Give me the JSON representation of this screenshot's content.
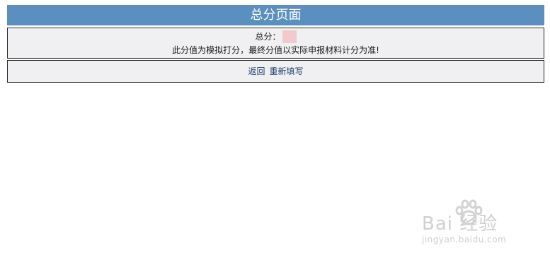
{
  "header": {
    "title": "总分页面"
  },
  "score": {
    "label": "总分：",
    "value": "",
    "note": "此分值为模拟打分，最终分值以实际申报材料计分为准!"
  },
  "actions": {
    "back_label": "返回",
    "refill_label": "重新填写"
  },
  "watermark": {
    "brand": "Bai 经验",
    "url": "jingyan.baidu.com"
  },
  "colors": {
    "header_bg": "#5b8fc0",
    "panel_bg": "#f0eff2",
    "panel_border": "#2a2a2a",
    "score_highlight": "#f2c9cc"
  }
}
